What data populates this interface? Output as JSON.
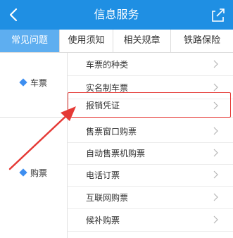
{
  "header": {
    "title": "信息服务",
    "back_icon": "chevron-left-icon",
    "share_icon": "share-icon"
  },
  "tabs": [
    {
      "label": "常见问题",
      "active": true
    },
    {
      "label": "使用须知",
      "active": false
    },
    {
      "label": "相关规章",
      "active": false
    },
    {
      "label": "铁路保险",
      "active": false
    }
  ],
  "categories": [
    {
      "label": "车票",
      "icon": "diamond-bullet-icon"
    },
    {
      "label": "购票",
      "icon": "diamond-bullet-icon"
    }
  ],
  "items": [
    {
      "label": "车票的种类"
    },
    {
      "label": "实名制车票"
    },
    {
      "label": "报销凭证",
      "highlighted": true
    },
    {
      "label": "售票窗口购票"
    },
    {
      "label": "自动售票机购票"
    },
    {
      "label": "电话订票"
    },
    {
      "label": "互联网购票"
    },
    {
      "label": "候补购票"
    }
  ],
  "colors": {
    "header_bg": "#1f8fe3",
    "active_tab_bg": "#5eaef0",
    "annotation_red": "#e53935",
    "bullet_blue": "#3d8ef0"
  }
}
